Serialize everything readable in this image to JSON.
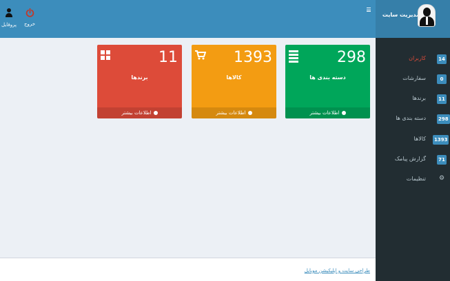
{
  "header": {
    "logout_label": "خروج",
    "profile_label": "پروفایل"
  },
  "brand": {
    "title": "مدیریت سایت"
  },
  "sidebar": {
    "items": [
      {
        "label": "کاربران",
        "badge": "14"
      },
      {
        "label": "سفارشات",
        "badge": "0"
      },
      {
        "label": "برندها",
        "badge": "11"
      },
      {
        "label": "دسته بندی ها",
        "badge": "298"
      },
      {
        "label": "کالاها",
        "badge": "1393"
      },
      {
        "label": "گزارش پیامک",
        "badge": "71"
      },
      {
        "label": "تنظیمات",
        "icon": "gear-icon"
      }
    ]
  },
  "boxes": [
    {
      "count": "298",
      "title": "دسته بندی ها",
      "more": "اطلاعات بیشتر",
      "color": "#00a65a",
      "icon": "list-icon"
    },
    {
      "count": "1393",
      "title": "کالاها",
      "more": "اطلاعات بیشتر",
      "color": "#f39c12",
      "icon": "cart-icon"
    },
    {
      "count": "11",
      "title": "برندها",
      "more": "اطلاعات بیشتر",
      "color": "#dd4b39",
      "icon": "grid-icon"
    }
  ],
  "footer": {
    "link_text": "طراحی سایت و اپلیکیشن موبایل"
  },
  "colors": {
    "header": "#3c8dbc",
    "sidebar": "#222d32",
    "badge": "#3c8dbc",
    "active": "#dd4b39"
  }
}
